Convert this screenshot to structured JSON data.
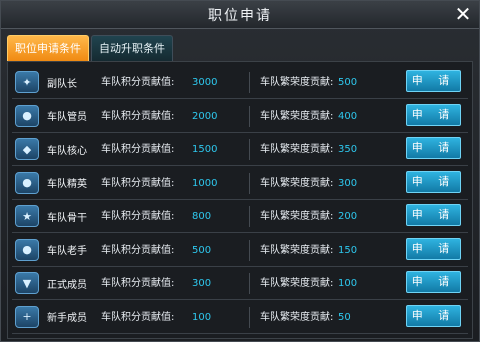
{
  "window": {
    "title": "职位申请",
    "close_symbol": "✕"
  },
  "tabs": [
    {
      "label": "职位申请条件",
      "active": true
    },
    {
      "label": "自动升职条件",
      "active": false
    }
  ],
  "columns": {
    "points_label": "车队积分贡献值:",
    "honor_label": "车队繁荣度贡献:",
    "apply_label": "申 请"
  },
  "rows": [
    {
      "rank": "副队长",
      "icon": "wings-badge-icon",
      "glyph": "✦",
      "points": "3000",
      "honor": "500"
    },
    {
      "rank": "车队管员",
      "icon": "person-badge-icon",
      "glyph": "●",
      "points": "2000",
      "honor": "400"
    },
    {
      "rank": "车队核心",
      "icon": "group-badge-icon",
      "glyph": "◆",
      "points": "1500",
      "honor": "350"
    },
    {
      "rank": "车队精英",
      "icon": "person-badge-icon",
      "glyph": "●",
      "points": "1000",
      "honor": "300"
    },
    {
      "rank": "车队骨干",
      "icon": "star-badge-icon",
      "glyph": "★",
      "points": "800",
      "honor": "200"
    },
    {
      "rank": "车队老手",
      "icon": "person-badge-icon",
      "glyph": "●",
      "points": "500",
      "honor": "150"
    },
    {
      "rank": "正式成员",
      "icon": "shield-badge-icon",
      "glyph": "▼",
      "points": "300",
      "honor": "100"
    },
    {
      "rank": "新手成员",
      "icon": "plus-badge-icon",
      "glyph": "+",
      "points": "100",
      "honor": "50"
    }
  ],
  "colors": {
    "accent_orange": "#f08a12",
    "value_cyan": "#2ec8ee",
    "button_blue": "#1a8fbd"
  }
}
